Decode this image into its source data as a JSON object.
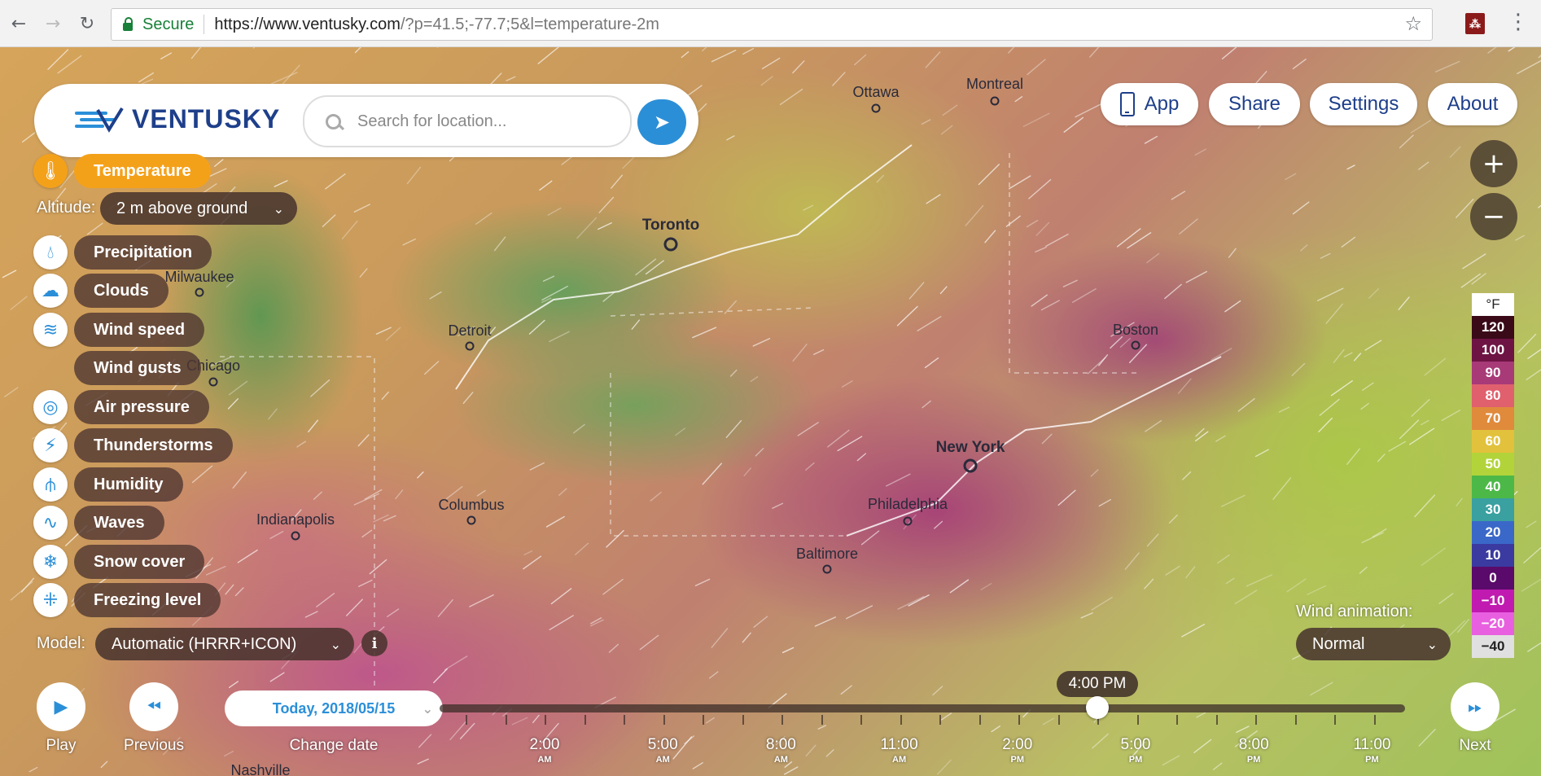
{
  "browser": {
    "secure_label": "Secure",
    "url_host": "https://www.ventusky.com",
    "url_rest": "/?p=41.5;-77.7;5&l=temperature-2m"
  },
  "header": {
    "logo_text": "VENTUSKY",
    "search_placeholder": "Search for location...",
    "buttons": {
      "app": "App",
      "share": "Share",
      "settings": "Settings",
      "about": "About"
    }
  },
  "layers": {
    "active": "Temperature",
    "altitude_label": "Altitude:",
    "altitude_value": "2 m above ground",
    "items": [
      "Precipitation",
      "Clouds",
      "Wind speed",
      "Wind gusts",
      "Air pressure",
      "Thunderstorms",
      "Humidity",
      "Waves",
      "Snow cover",
      "Freezing level"
    ]
  },
  "model": {
    "label": "Model:",
    "value": "Automatic (HRRR+ICON)"
  },
  "wind_animation": {
    "label": "Wind animation:",
    "value": "Normal"
  },
  "legend": {
    "unit": "°F",
    "values": [
      "120",
      "100",
      "90",
      "80",
      "70",
      "60",
      "50",
      "40",
      "30",
      "20",
      "10",
      "0",
      "−10",
      "−20",
      "−40"
    ],
    "colors": [
      "#3a0a18",
      "#6e1444",
      "#a83a78",
      "#e0606e",
      "#e08a3c",
      "#e2c23c",
      "#b2d43a",
      "#4cb848",
      "#3aa0a0",
      "#3a68c8",
      "#3a3aa0",
      "#5a0a6a",
      "#c01ab0",
      "#e860e0",
      "#e0e0e0"
    ]
  },
  "cities": {
    "ottawa": "Ottawa",
    "montreal": "Montreal",
    "toronto": "Toronto",
    "milwaukee": "Milwaukee",
    "detroit": "Detroit",
    "boston": "Boston",
    "chicago": "Chicago",
    "new_york": "New York",
    "columbus": "Columbus",
    "indianapolis": "Indianapolis",
    "philadelphia": "Philadelphia",
    "baltimore": "Baltimore",
    "nashville": "Nashville"
  },
  "timeline": {
    "play": "Play",
    "previous": "Previous",
    "change_date": "Change date",
    "next": "Next",
    "date": "Today, 2018/05/15",
    "current_time": "4:00 PM",
    "hours": [
      {
        "time": "2:00",
        "ampm": "AM"
      },
      {
        "time": "5:00",
        "ampm": "AM"
      },
      {
        "time": "8:00",
        "ampm": "AM"
      },
      {
        "time": "11:00",
        "ampm": "AM"
      },
      {
        "time": "2:00",
        "ampm": "PM"
      },
      {
        "time": "5:00",
        "ampm": "PM"
      },
      {
        "time": "8:00",
        "ampm": "PM"
      },
      {
        "time": "11:00",
        "ampm": "PM"
      }
    ]
  },
  "icons": {
    "temperature": "thermometer-icon",
    "precipitation": "drop-icon",
    "clouds": "cloud-icon",
    "wind": "wind-icon",
    "pressure": "pressure-icon",
    "thunder": "lightning-icon",
    "humidity": "humidity-icon",
    "waves": "waves-icon",
    "snow": "snowflake-icon",
    "freezing": "freezing-icon"
  }
}
